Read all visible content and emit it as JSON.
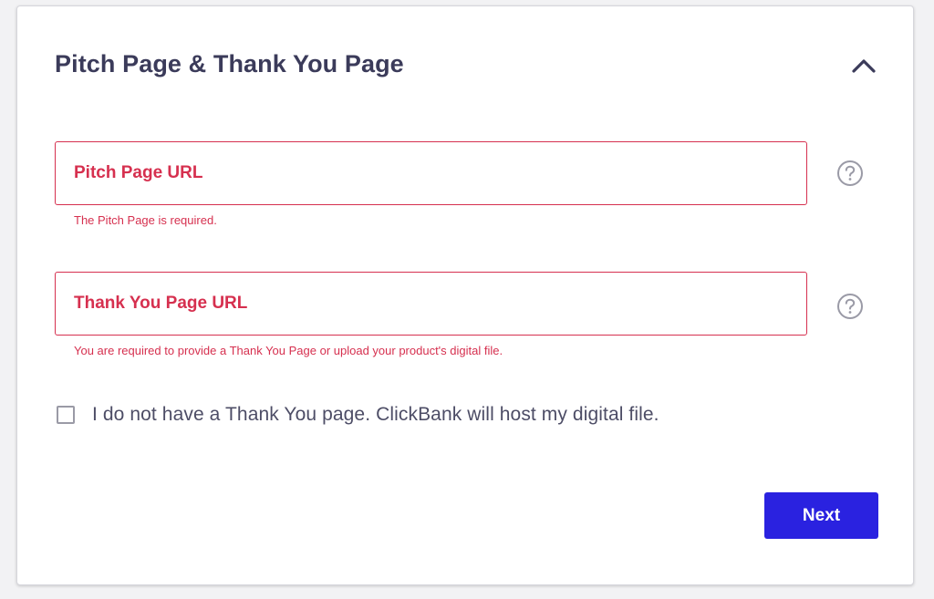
{
  "section": {
    "title": "Pitch Page & Thank You Page"
  },
  "pitch_page": {
    "placeholder": "Pitch Page URL",
    "value": "",
    "error": "The Pitch Page is required."
  },
  "thank_you_page": {
    "placeholder": "Thank You Page URL",
    "value": "",
    "error": "You are required to provide a Thank You Page or upload your product's digital file."
  },
  "hosting_option": {
    "label": "I do not have a Thank You page. ClickBank will host my digital file.",
    "checked": false
  },
  "actions": {
    "next_label": "Next"
  },
  "icons": {
    "collapse": "chevron-up-icon",
    "help": "question-circle-icon"
  },
  "colors": {
    "error": "#d6304f",
    "primary_button": "#2a22e0",
    "title": "#3b3b5a"
  }
}
